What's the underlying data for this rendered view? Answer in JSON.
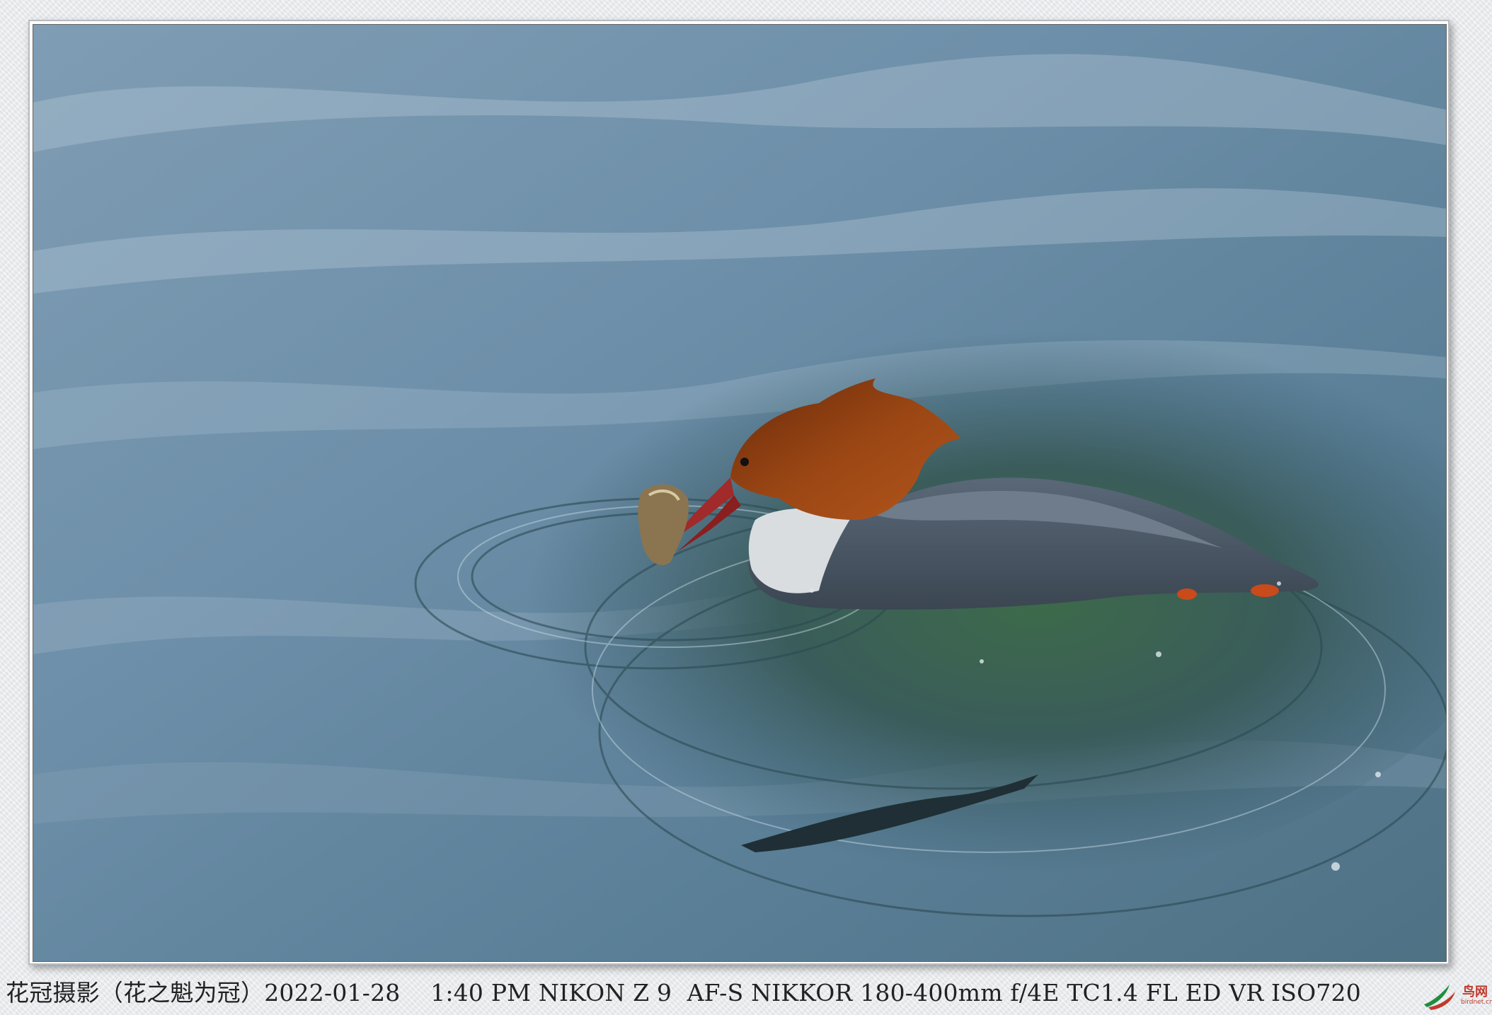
{
  "caption": {
    "text": "花冠摄影（花之魁为冠）2022-01-28    1:40 PM NIKON Z 9  AF-S NIKKOR 180-400mm f/4E TC1.4 FL ED VR ISO720"
  },
  "watermark": {
    "name": "鸟网",
    "domain": "birdnet.cn"
  },
  "colors": {
    "water": "#6d8fa8",
    "water_dark": "#2f4e5c",
    "head": "#8a3c10",
    "body": "#4a5766"
  }
}
